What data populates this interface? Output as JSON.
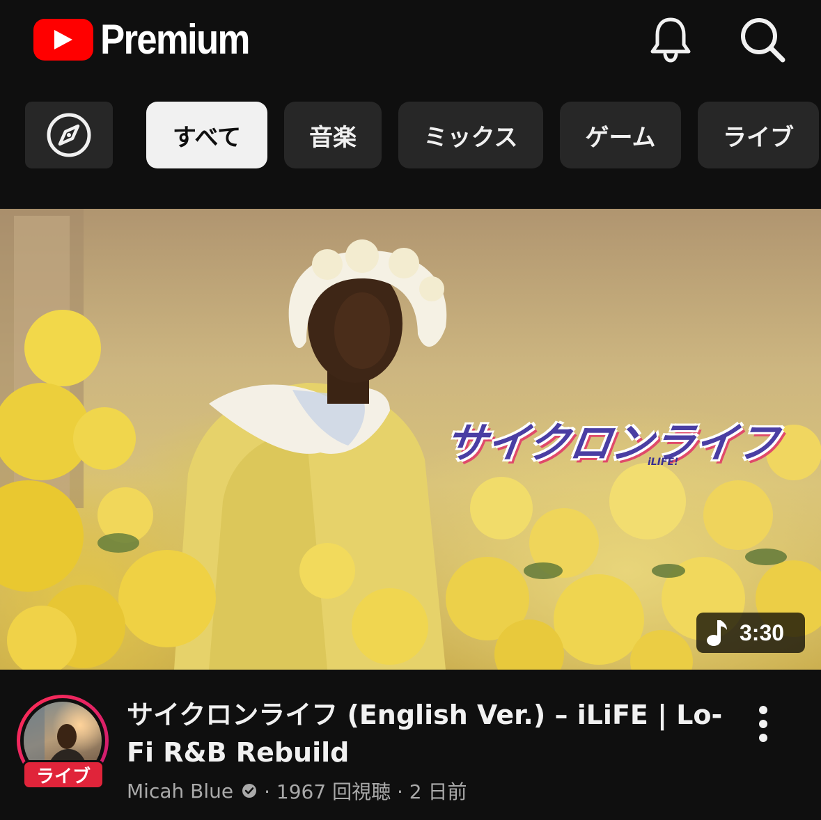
{
  "header": {
    "logo_text": "Premium",
    "icons": [
      "youtube-logo-icon",
      "notifications-bell-icon",
      "search-icon"
    ]
  },
  "chips": {
    "explore_icon": "compass-icon",
    "items": [
      {
        "label": "すべて",
        "active": true
      },
      {
        "label": "音楽",
        "active": false
      },
      {
        "label": "ミックス",
        "active": false
      },
      {
        "label": "ゲーム",
        "active": false
      },
      {
        "label": "ライブ",
        "active": false
      }
    ]
  },
  "video": {
    "thumbnail_title": "サイクロンライフ",
    "thumbnail_subtitle": "iLIFE!",
    "duration": "3:30",
    "duration_icon": "music-note-icon",
    "title": "サイクロンライフ (English Ver.) – iLiFE | Lo-Fi R&B Rebuild",
    "channel": "Micah Blue",
    "stats": "· 1967 回視聴 · 2 日前",
    "live_badge": "ライブ",
    "verified_icon": "verified-badge-icon",
    "more_icon": "more-vertical-icon"
  },
  "colors": {
    "background": "#0f0f0f",
    "chip": "#272727",
    "chip_active": "#f1f1f1",
    "brand_red": "#ff0000",
    "live_red": "#e0243a",
    "secondary_text": "#aaaaaa"
  }
}
